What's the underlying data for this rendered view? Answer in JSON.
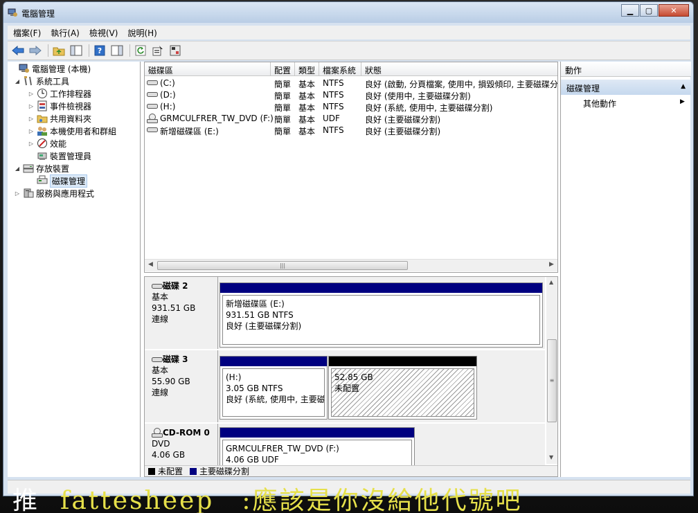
{
  "window": {
    "title": "電腦管理"
  },
  "menu": [
    "檔案(F)",
    "執行(A)",
    "檢視(V)",
    "說明(H)"
  ],
  "tree": {
    "root": "電腦管理 (本機)",
    "system_tools": "系統工具",
    "task_scheduler": "工作排程器",
    "event_viewer": "事件檢視器",
    "shared_folders": "共用資料夾",
    "local_users": "本機使用者和群組",
    "performance": "效能",
    "device_manager": "裝置管理員",
    "storage": "存放裝置",
    "disk_management": "磁碟管理",
    "services": "服務與應用程式"
  },
  "volume_list": {
    "headers": {
      "volume": "磁碟區",
      "layout": "配置",
      "type": "類型",
      "fs": "檔案系統",
      "status": "狀態"
    },
    "rows": [
      {
        "volume": "(C:)",
        "layout": "簡單",
        "type": "基本",
        "fs": "NTFS",
        "status": "良好 (啟動, 分頁檔案, 使用中, 損毀傾印, 主要磁碟分割)"
      },
      {
        "volume": "(D:)",
        "layout": "簡單",
        "type": "基本",
        "fs": "NTFS",
        "status": "良好 (使用中, 主要磁碟分割)"
      },
      {
        "volume": "(H:)",
        "layout": "簡單",
        "type": "基本",
        "fs": "NTFS",
        "status": "良好 (系統, 使用中, 主要磁碟分割)"
      },
      {
        "volume": "GRMCULFRER_TW_DVD (F:)",
        "layout": "簡單",
        "type": "基本",
        "fs": "UDF",
        "status": "良好 (主要磁碟分割)"
      },
      {
        "volume": "新增磁碟區 (E:)",
        "layout": "簡單",
        "type": "基本",
        "fs": "NTFS",
        "status": "良好 (主要磁碟分割)"
      }
    ]
  },
  "disks": {
    "disk2": {
      "name": "磁碟 2",
      "kind": "基本",
      "size": "931.51 GB",
      "state": "連線",
      "p1": {
        "name": "新增磁碟區 (E:)",
        "size": "931.51 GB NTFS",
        "status": "良好 (主要磁碟分割)"
      }
    },
    "disk3": {
      "name": "磁碟 3",
      "kind": "基本",
      "size": "55.90 GB",
      "state": "連線",
      "p1": {
        "name": "(H:)",
        "size": "3.05 GB NTFS",
        "status": "良好 (系統, 使用中, 主要磁碟分割)"
      },
      "p2": {
        "size": "52.85 GB",
        "status": "未配置"
      }
    },
    "cdrom0": {
      "name": "CD-ROM 0",
      "kind": "DVD",
      "size": "4.06 GB",
      "p1": {
        "name": "GRMCULFRER_TW_DVD (F:)",
        "size": "4.06 GB UDF"
      }
    }
  },
  "legend": {
    "unallocated": "未配置",
    "primary": "主要磁碟分割"
  },
  "actions": {
    "header": "動作",
    "section": "磁碟管理",
    "more": "其他動作"
  },
  "overlay": {
    "prefix": "推",
    "name": "fattesheep",
    "message": ":應該是你沒給他代號吧"
  },
  "colors": {
    "primary_partition": "#000080",
    "unallocated": "#000000"
  }
}
